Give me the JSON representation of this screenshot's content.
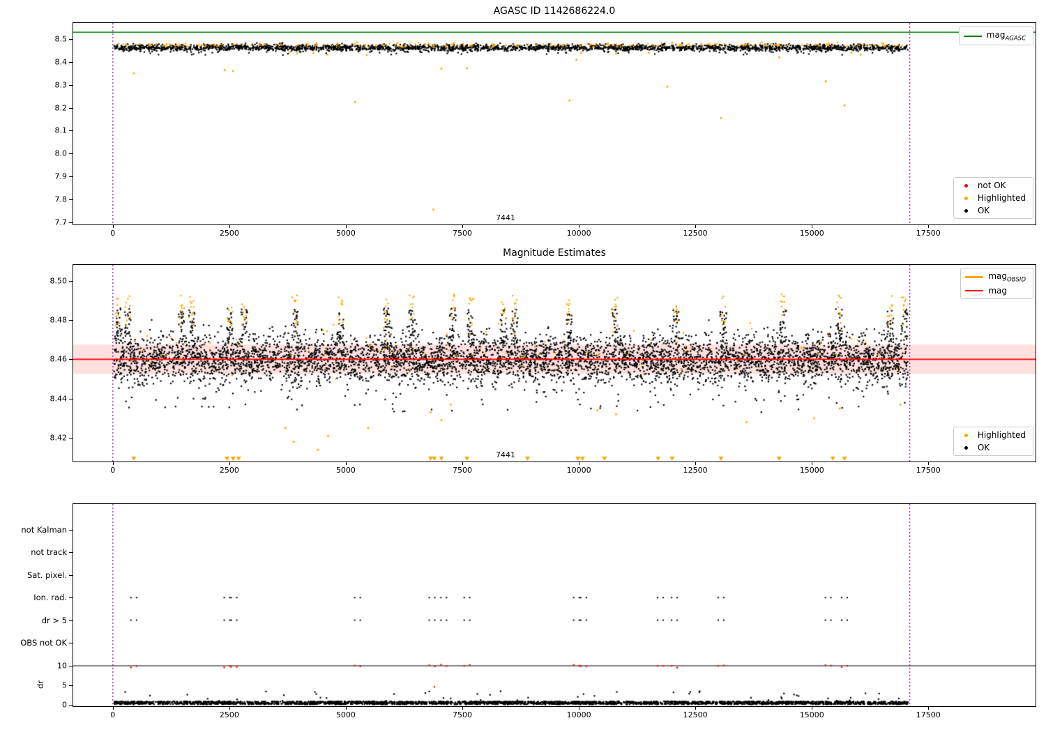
{
  "figure": {
    "background": "#ffffff",
    "xlim": [
      -850,
      19800
    ],
    "xtick_values": [
      0,
      2500,
      5000,
      7500,
      10000,
      12500,
      15000,
      17500
    ],
    "xtick_labels": [
      "0",
      "2500",
      "5000",
      "7500",
      "10000",
      "12500",
      "15000",
      "17500"
    ],
    "vlines": {
      "x": [
        0,
        17100
      ],
      "color": "#8B008B",
      "style": "dotted"
    },
    "colors": {
      "ok": "#000000",
      "highlighted": "#FFA500",
      "not_ok": "#FF0000",
      "mag_agasc_line": "#008000",
      "mag_line": "#FF0000",
      "band": "rgba(255,0,0,0.12)"
    }
  },
  "chart_data": [
    {
      "type": "scatter",
      "title": "AGASC ID 1142686224.0",
      "ylim": [
        7.69,
        8.57
      ],
      "yticks": [
        {
          "v": 7.7,
          "label": "7.7"
        },
        {
          "v": 7.8,
          "label": "7.8"
        },
        {
          "v": 7.9,
          "label": "7.9"
        },
        {
          "v": 8.0,
          "label": "8.0"
        },
        {
          "v": 8.1,
          "label": "8.1"
        },
        {
          "v": 8.2,
          "label": "8.2"
        },
        {
          "v": 8.3,
          "label": "8.3"
        },
        {
          "v": 8.4,
          "label": "8.4"
        },
        {
          "v": 8.5,
          "label": "8.5"
        }
      ],
      "hline": {
        "y": 8.53,
        "color": "#008000",
        "label": "mag",
        "label_sub": "AGASC"
      },
      "annotation": {
        "text": "7441",
        "x": 7441,
        "y": 7.703
      },
      "legend_line": {
        "entries": [
          {
            "type": "line",
            "color": "#008000",
            "width": 2,
            "label": "mag",
            "sub": "AGASC"
          }
        ]
      },
      "legend_markers": {
        "entries": [
          {
            "type": "dot",
            "color": "#FF0000",
            "label": "not OK"
          },
          {
            "type": "dot",
            "color": "#FFA500",
            "label": "Highlighted"
          },
          {
            "type": "dot",
            "color": "#000000",
            "label": "OK"
          }
        ]
      },
      "series": {
        "ok_band": {
          "n": 2600,
          "x_range": [
            30,
            17060
          ],
          "y_mean": 8.462,
          "y_sigma": 0.007,
          "y_clip": [
            8.44,
            8.483
          ],
          "color": "#000000"
        },
        "ok_low": {
          "n": 60,
          "x_range": [
            30,
            17060
          ],
          "y_range": [
            8.43,
            8.452
          ],
          "color": "#000000"
        },
        "hl_band": {
          "n": 230,
          "x_range": [
            30,
            17060
          ],
          "y_mean": 8.474,
          "y_sigma": 0.0045,
          "y_clip": [
            8.462,
            8.486
          ],
          "color": "#FFA500"
        },
        "hl_outliers": {
          "color": "#FFA500",
          "points": [
            [
              450,
              8.35
            ],
            [
              2400,
              8.365
            ],
            [
              2580,
              8.36
            ],
            [
              3800,
              8.443
            ],
            [
              3950,
              8.437
            ],
            [
              4300,
              8.44
            ],
            [
              4600,
              8.432
            ],
            [
              5200,
              8.225
            ],
            [
              5450,
              8.43
            ],
            [
              6880,
              7.755
            ],
            [
              7050,
              8.37
            ],
            [
              7600,
              8.372
            ],
            [
              9800,
              8.232
            ],
            [
              9950,
              8.41
            ],
            [
              10050,
              8.44
            ],
            [
              10800,
              8.437
            ],
            [
              11500,
              8.44
            ],
            [
              11900,
              8.292
            ],
            [
              13050,
              8.155
            ],
            [
              14300,
              8.42
            ],
            [
              15300,
              8.315
            ],
            [
              15700,
              8.21
            ],
            [
              15850,
              8.44
            ],
            [
              16050,
              8.432
            ]
          ]
        }
      }
    },
    {
      "type": "scatter",
      "title": "Magnitude Estimates",
      "ylim": [
        8.408,
        8.508
      ],
      "yticks": [
        {
          "v": 8.42,
          "label": "8.42"
        },
        {
          "v": 8.44,
          "label": "8.44"
        },
        {
          "v": 8.46,
          "label": "8.46"
        },
        {
          "v": 8.48,
          "label": "8.48"
        },
        {
          "v": 8.5,
          "label": "8.50"
        }
      ],
      "hline": {
        "y": 8.46,
        "color": "#FF0000",
        "label": "mag"
      },
      "band": {
        "y0": 8.4525,
        "y1": 8.4675,
        "color": "rgba(255,0,0,0.12)"
      },
      "annotation": {
        "text": "7441",
        "x": 7441,
        "y": 8.41
      },
      "legend_line": {
        "entries": [
          {
            "type": "line",
            "color": "#FFA500",
            "width": 3,
            "label": "mag",
            "sub": "OBSID"
          },
          {
            "type": "line",
            "color": "#FF0000",
            "width": 2,
            "label": "mag"
          }
        ]
      },
      "legend_markers": {
        "entries": [
          {
            "type": "dot",
            "color": "#FFA500",
            "label": "Highlighted"
          },
          {
            "type": "dot",
            "color": "#000000",
            "label": "OK"
          }
        ]
      },
      "series": {
        "ok_band": {
          "n": 5200,
          "x_range": [
            30,
            17060
          ],
          "y_mean": 8.46,
          "y_sigma": 0.006,
          "y_clip": [
            8.433,
            8.486
          ],
          "color": "#000000"
        },
        "ok_low": {
          "n": 120,
          "x_range": [
            30,
            17060
          ],
          "y_range": [
            8.433,
            8.45
          ],
          "color": "#000000"
        },
        "hl_band": {
          "n": 110,
          "x_range": [
            30,
            17060
          ],
          "y_mean": 8.466,
          "y_sigma": 0.006,
          "y_clip": [
            8.45,
            8.487
          ],
          "color": "#FFA500"
        },
        "spikes": {
          "x": [
            120,
            320,
            1480,
            1700,
            2520,
            2820,
            3900,
            4880,
            5880,
            6420,
            7300,
            7680,
            8380,
            8620,
            9780,
            10780,
            12080,
            13100,
            14380,
            15580,
            16680,
            16980
          ],
          "ok": {
            "per": 24,
            "x_jitter": 70,
            "y_range": [
              8.468,
              8.486
            ],
            "color": "#000000"
          },
          "hl": {
            "per": 9,
            "x_jitter": 55,
            "y_range": [
              8.477,
              8.493
            ],
            "color": "#FFA500"
          }
        },
        "hl_low": {
          "color": "#FFA500",
          "points": [
            [
              3700,
              8.425
            ],
            [
              3880,
              8.418
            ],
            [
              4400,
              8.414
            ],
            [
              4620,
              8.421
            ],
            [
              5480,
              8.425
            ],
            [
              6820,
              8.433
            ],
            [
              7050,
              8.429
            ],
            [
              7250,
              8.437
            ],
            [
              10400,
              8.434
            ],
            [
              10800,
              8.432
            ],
            [
              13600,
              8.428
            ],
            [
              15050,
              8.43
            ],
            [
              15600,
              8.435
            ],
            [
              16900,
              8.437
            ]
          ]
        },
        "clipped_low_markers": {
          "color": "#FFA500",
          "symbol": "triangle-down",
          "x": [
            450,
            2450,
            2580,
            2700,
            6820,
            6900,
            7050,
            7600,
            8900,
            9980,
            10080,
            10550,
            11700,
            12000,
            13050,
            14300,
            15450,
            15700
          ]
        }
      }
    },
    {
      "type": "scatter",
      "title": "",
      "categories": [
        "not Kalman",
        "not track",
        "Sat. pixel.",
        "Ion. rad.",
        "dr > 5",
        "OBS not OK"
      ],
      "flag_x": [
        450,
        2450,
        2600,
        5250,
        6850,
        7100,
        7600,
        9950,
        10100,
        11750,
        12050,
        13050,
        15350,
        15700
      ],
      "flag_rows": [
        3,
        4
      ],
      "flag_color": "#000000",
      "dr": {
        "label": "dr",
        "ticks": [
          {
            "v": 0,
            "label": "0"
          },
          {
            "v": 5,
            "label": "5"
          },
          {
            "v": 10,
            "label": "10"
          }
        ],
        "threshold": 10,
        "threshold_color": "#000000",
        "ok_base": {
          "n": 2800,
          "x_range": [
            30,
            17060
          ],
          "y_range": [
            0.1,
            0.9
          ],
          "color": "#000000"
        },
        "ok_mid": {
          "n": 50,
          "x_range": [
            30,
            17060
          ],
          "y_range": [
            1.0,
            3.6
          ],
          "color": "#000000"
        },
        "not_ok_y_range": [
          9.5,
          10.3
        ],
        "not_ok_color": "#FF0000",
        "extra_not_ok": [
          [
            6900,
            4.6
          ]
        ]
      }
    }
  ]
}
